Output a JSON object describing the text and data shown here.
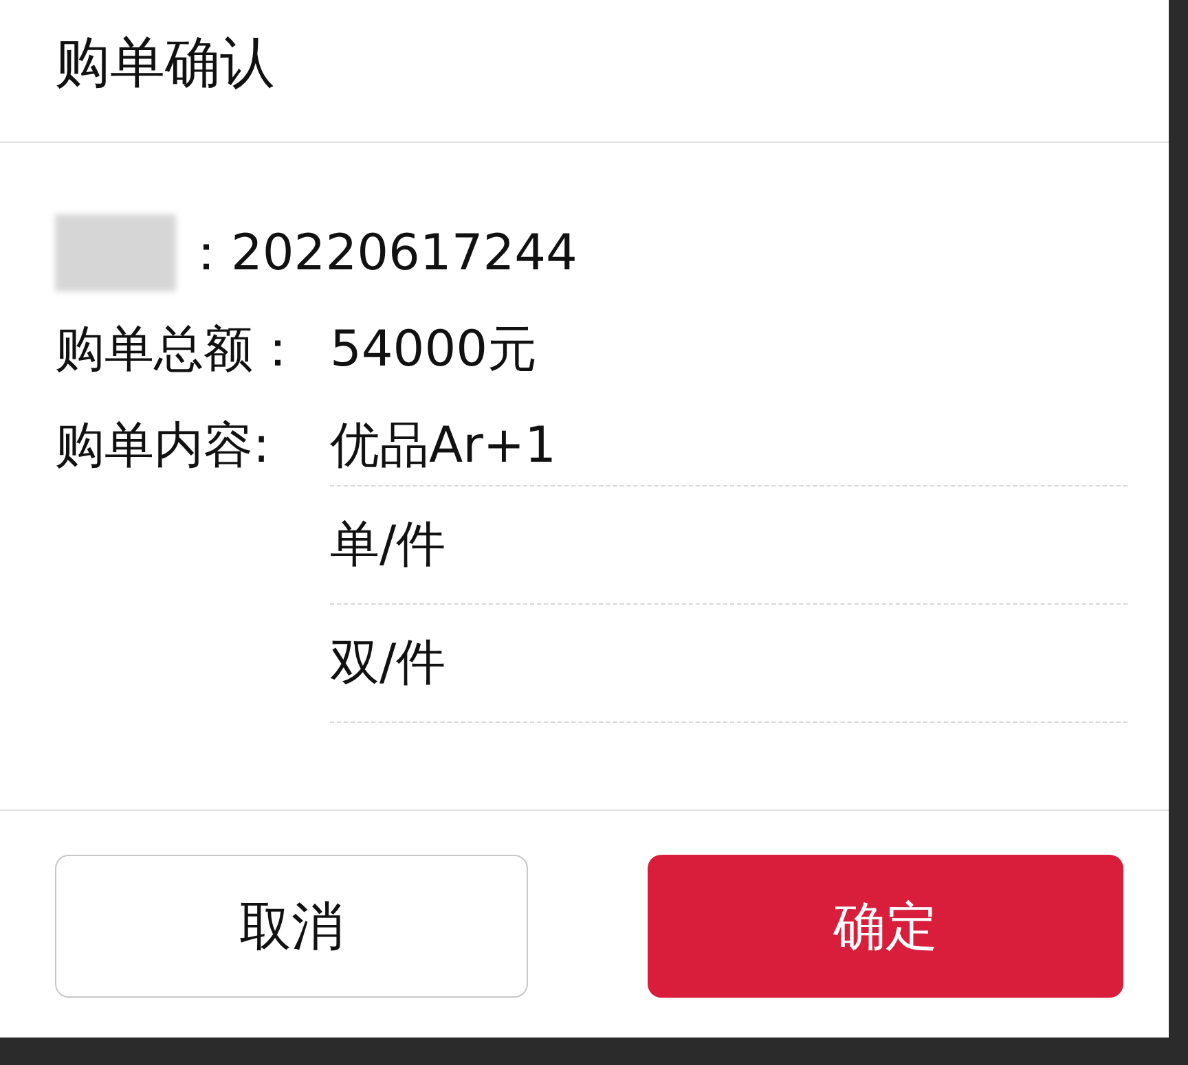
{
  "dialog": {
    "title": "购单确认",
    "fields": [
      {
        "kind": "redacted",
        "value": "：20220617244"
      },
      {
        "kind": "labeled",
        "label": "购单总额：",
        "value": "54000元"
      },
      {
        "kind": "labeled",
        "label": "购单内容:",
        "value": "优品Ar+1"
      }
    ],
    "options": [
      "单/件",
      "双/件"
    ],
    "buttons": [
      {
        "label": "取消",
        "kind": "secondary"
      },
      {
        "label": "确定",
        "kind": "primary"
      }
    ]
  }
}
